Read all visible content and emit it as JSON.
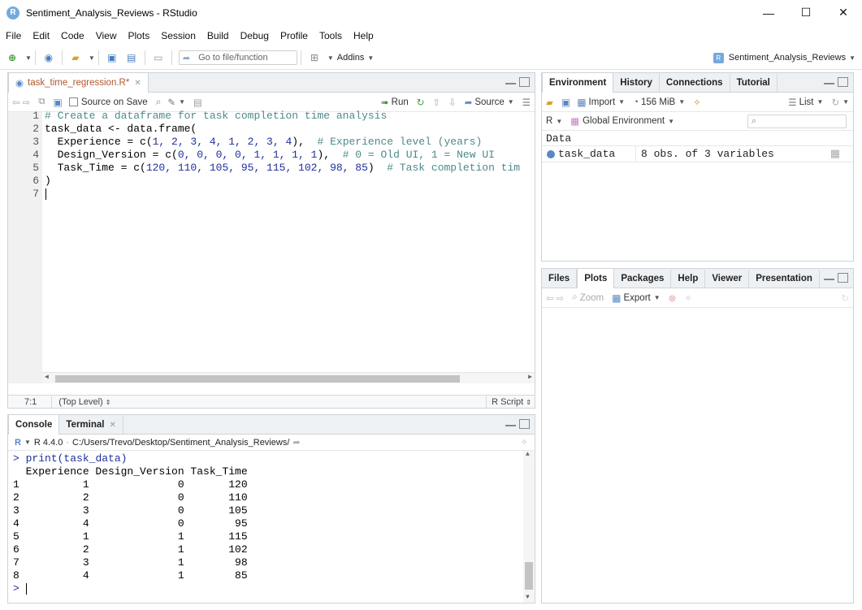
{
  "window": {
    "title": "Sentiment_Analysis_Reviews - RStudio",
    "logo_letter": "R",
    "minimize": "—",
    "maximize": "☐",
    "close": "✕"
  },
  "menu": [
    "File",
    "Edit",
    "Code",
    "View",
    "Plots",
    "Session",
    "Build",
    "Debug",
    "Profile",
    "Tools",
    "Help"
  ],
  "toolbar": {
    "goto_placeholder": "Go to file/function",
    "addins_label": "Addins",
    "project_name": "Sentiment_Analysis_Reviews"
  },
  "source": {
    "tab_label": "task_time_regression.R*",
    "source_on_save_label": "Source on Save",
    "run_label": "Run",
    "source_label": "Source",
    "lines": [
      "1",
      "2",
      "3",
      "4",
      "5",
      "6",
      "7"
    ],
    "code": {
      "l1": "# Create a dataframe for task completion time analysis",
      "l2a": "task_data <- data.frame(",
      "l3a": "  Experience = c(",
      "l3b": "1, 2, 3, 4, 1, 2, 3, 4",
      "l3c": "),  ",
      "l3d": "# Experience level (years)",
      "l4a": "  Design_Version = c(",
      "l4b": "0, 0, 0, 0, 1, 1, 1, 1",
      "l4c": "),  ",
      "l4d": "# 0 = Old UI, 1 = New UI",
      "l5a": "  Task_Time = c(",
      "l5b": "120, 110, 105, 95, 115, 102, 98, 85",
      "l5c": ")  ",
      "l5d": "# Task completion tim",
      "l6": ")"
    },
    "cursor_pos": "7:1",
    "scope": "(Top Level)",
    "file_type": "R Script"
  },
  "console": {
    "tab_console": "Console",
    "tab_terminal": "Terminal",
    "r_version": "R 4.4.0",
    "path": "C:/Users/Trevo/Desktop/Sentiment_Analysis_Reviews/",
    "command": "print(task_data)",
    "header": "  Experience Design_Version Task_Time",
    "rows": [
      "1          1              0       120",
      "2          2              0       110",
      "3          3              0       105",
      "4          4              0        95",
      "5          1              1       115",
      "6          2              1       102",
      "7          3              1        98",
      "8          4              1        85"
    ],
    "prompt": ">"
  },
  "environment": {
    "tabs": [
      "Environment",
      "History",
      "Connections",
      "Tutorial"
    ],
    "import_label": "Import",
    "memory_label": "156 MiB",
    "list_label": "List",
    "lang_label": "R",
    "scope_label": "Global Environment",
    "section": "Data",
    "var_name": "task_data",
    "var_value": "8 obs. of 3 variables"
  },
  "files": {
    "tabs": [
      "Files",
      "Plots",
      "Packages",
      "Help",
      "Viewer",
      "Presentation"
    ],
    "zoom_label": "Zoom",
    "export_label": "Export"
  }
}
